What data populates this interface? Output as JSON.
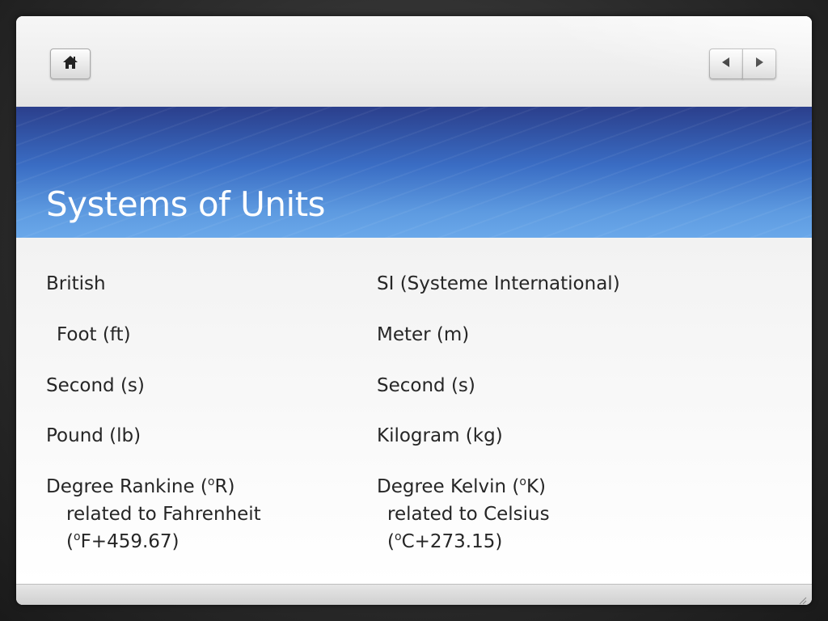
{
  "slide": {
    "title": "Systems of Units",
    "left_column": {
      "heading": "British",
      "items": [
        "Foot (ft)",
        "Second (s)",
        "Pound (lb)"
      ],
      "temperature": {
        "label_before": "Degree Rankine (",
        "sup": "o",
        "label_after": "R)",
        "line2": "related to Fahrenheit",
        "line3_open": "(",
        "line3_sup": "o",
        "line3_rest": "F+459.67)"
      }
    },
    "right_column": {
      "heading": "SI (Systeme International)",
      "items": [
        "Meter (m)",
        "Second (s)",
        "Kilogram (kg)"
      ],
      "temperature": {
        "label_before": "Degree Kelvin (",
        "sup": "o",
        "label_after": "K)",
        "line2": "related to Celsius",
        "line3_open": "(",
        "line3_sup": "o",
        "line3_rest": "C+273.15)"
      }
    }
  },
  "toolbar": {
    "home_icon": "home-icon",
    "prev_icon": "arrow-left-icon",
    "next_icon": "arrow-right-icon"
  },
  "colors": {
    "title_band_top": "#2b3f8c",
    "title_band_bottom": "#6aa8ea",
    "title_text": "#ffffff",
    "body_text": "#262626"
  }
}
